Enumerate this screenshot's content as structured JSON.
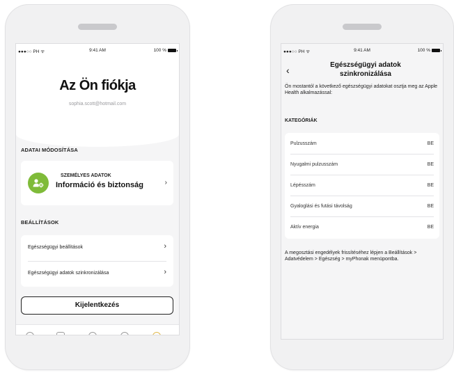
{
  "left_phone": {
    "status": {
      "carrier": "●●●○○ PH ᯤ",
      "time": "9:41 AM",
      "battery": "100 %"
    },
    "title": "Az Ön fiókja",
    "email": "sophia.scott@hotmail.com",
    "section_account": "ADATAI MÓDOSÍTÁSA",
    "personal": {
      "small_label": "SZEMÉLYES ADATOK",
      "big_label": "Információ és biztonság"
    },
    "section_settings": "BEÁLLÍTÁSOK",
    "settings_items": [
      {
        "label": "Egészségügyi beállítások"
      },
      {
        "label": "Egészségügyi adatok szinkronizálása"
      }
    ],
    "logout_label": "Kijelentkezés"
  },
  "right_phone": {
    "status": {
      "carrier": "●●●○○ PH ᯤ",
      "time": "9:41 AM",
      "battery": "100 %"
    },
    "title_line1": "Egészségügyi adatok",
    "title_line2": "szinkronizálása",
    "description": "Ön mostantól a következő egészségügyi adatokat osztja meg az Apple Health alkalmazással:",
    "categories_label": "KATEGÓRIÁK",
    "categories": [
      {
        "name": "Pulzusszám",
        "value": "BE"
      },
      {
        "name": "Nyugalmi pulzusszám",
        "value": "BE"
      },
      {
        "name": "Lépésszám",
        "value": "BE"
      },
      {
        "name": "Gyaloglási és futási távolság",
        "value": "BE"
      },
      {
        "name": "Aktív energia",
        "value": "BE"
      }
    ],
    "footer": "A megosztási engedélyek frissítéséhez lépjen a Beállítások > Adatvédelem > Egészség > myPhonak menüpontba."
  },
  "icons": {
    "avatar_color": "#7fbb39",
    "back": "chevron-left-icon",
    "chevron": "chevron-right-icon"
  }
}
